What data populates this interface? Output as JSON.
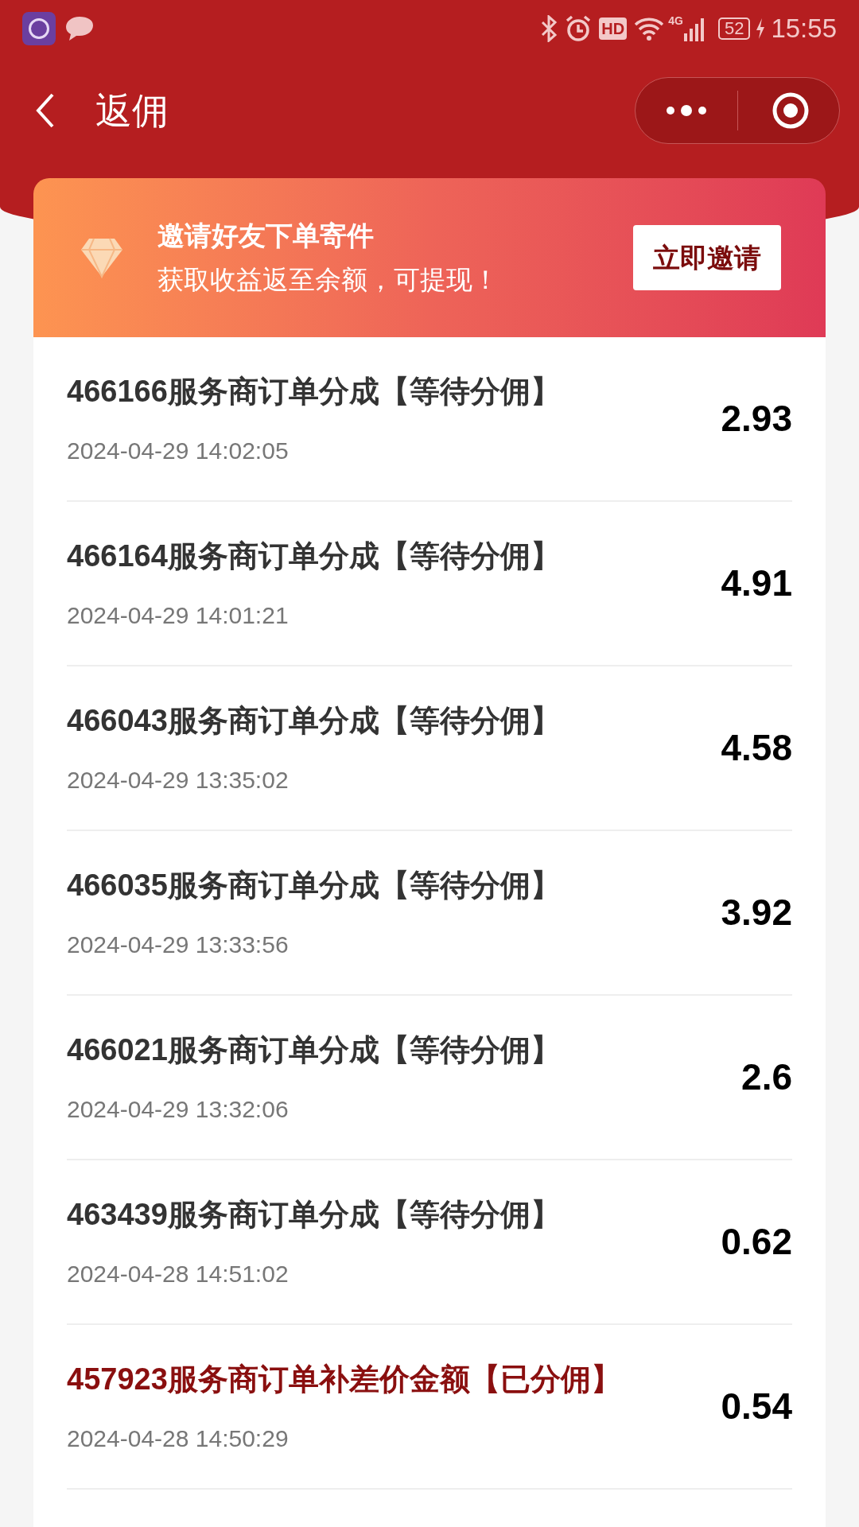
{
  "status_bar": {
    "hd": "HD",
    "network": "4G",
    "battery": "52",
    "time": "15:55"
  },
  "nav": {
    "title": "返佣"
  },
  "banner": {
    "title": "邀请好友下单寄件",
    "subtitle": "获取收益返至余额，可提现！",
    "button": "立即邀请"
  },
  "records": [
    {
      "title": "466166服务商订单分成【等待分佣】",
      "time": "2024-04-29 14:02:05",
      "amount": "2.93",
      "settled": false
    },
    {
      "title": "466164服务商订单分成【等待分佣】",
      "time": "2024-04-29 14:01:21",
      "amount": "4.91",
      "settled": false
    },
    {
      "title": "466043服务商订单分成【等待分佣】",
      "time": "2024-04-29 13:35:02",
      "amount": "4.58",
      "settled": false
    },
    {
      "title": "466035服务商订单分成【等待分佣】",
      "time": "2024-04-29 13:33:56",
      "amount": "3.92",
      "settled": false
    },
    {
      "title": "466021服务商订单分成【等待分佣】",
      "time": "2024-04-29 13:32:06",
      "amount": "2.6",
      "settled": false
    },
    {
      "title": "463439服务商订单分成【等待分佣】",
      "time": "2024-04-28 14:51:02",
      "amount": "0.62",
      "settled": false
    },
    {
      "title": "457923服务商订单补差价金额【已分佣】",
      "time": "2024-04-28 14:50:29",
      "amount": "0.54",
      "settled": true
    }
  ]
}
